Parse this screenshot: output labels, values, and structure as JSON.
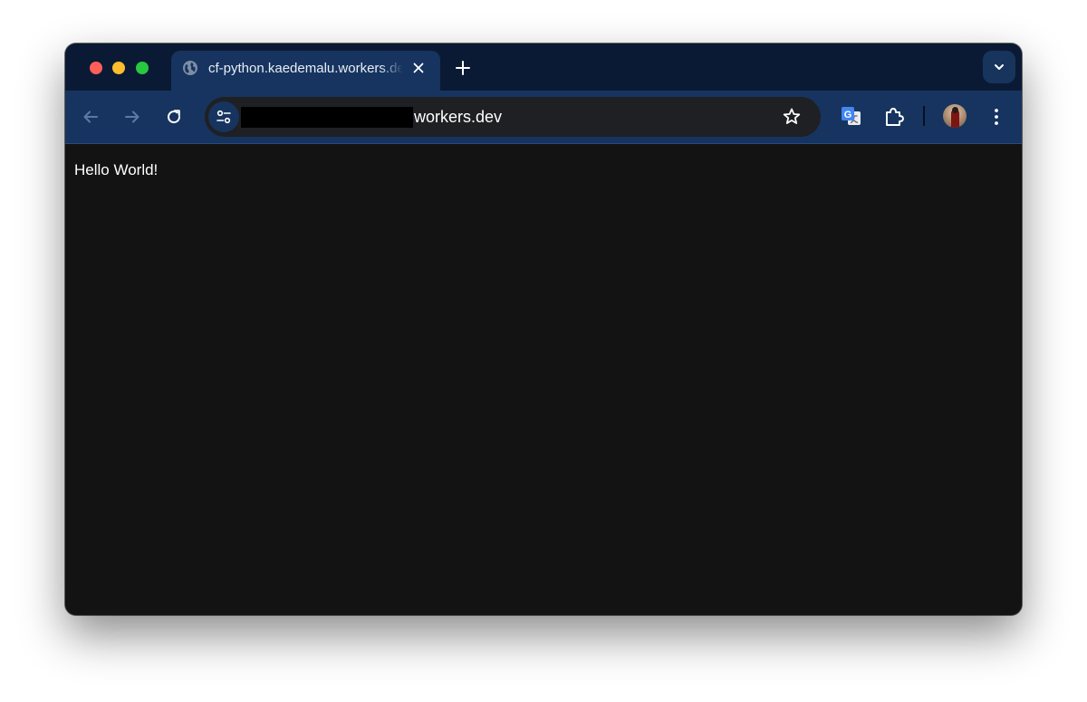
{
  "window": {
    "controls": [
      "close",
      "minimize",
      "zoom"
    ]
  },
  "tab": {
    "title": "cf-python.kaedemalu.workers.dev",
    "favicon": "globe-icon",
    "close_icon": "close-icon"
  },
  "tabstrip": {
    "new_tab_icon": "plus-icon",
    "tab_search_icon": "chevron-down-icon"
  },
  "toolbar": {
    "back_icon": "back-arrow-icon",
    "forward_icon": "forward-arrow-icon",
    "reload_icon": "reload-icon",
    "site_info_icon": "tune-icon",
    "url_visible": "workers.dev",
    "url_redacted": true,
    "bookmark_icon": "star-icon",
    "extensions": [
      "google-translate-icon",
      "puzzle-piece-icon"
    ],
    "profile": "avatar",
    "menu_icon": "kebab-menu-icon"
  },
  "page": {
    "body_text": "Hello World!"
  },
  "colors": {
    "tabstrip": "#0b1a34",
    "active_tab": "#16345f",
    "toolbar": "#16345f",
    "omnibox": "#1f2023",
    "page_background": "#131313",
    "text": "#ffffff"
  }
}
